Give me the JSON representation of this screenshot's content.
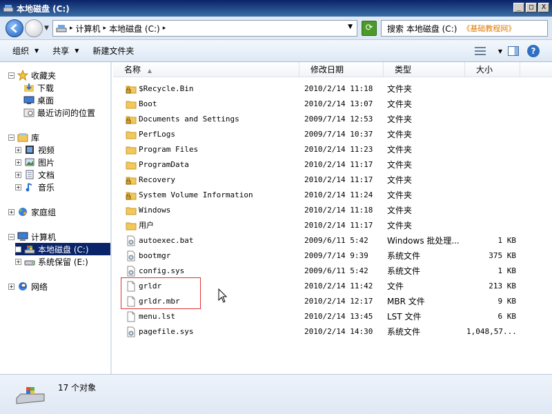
{
  "window": {
    "title": "本地磁盘 (C:)",
    "buttons": [
      "_",
      "□",
      "X"
    ]
  },
  "address": {
    "crumbs": [
      "计算机",
      "本地磁盘 (C:)"
    ],
    "search_placeholder": "搜索 本地磁盘 (C:)",
    "watermark": "《基础教程网》"
  },
  "toolbar": {
    "organize": "组织",
    "share": "共享",
    "new_folder": "新建文件夹"
  },
  "nav": {
    "favorites": "收藏夹",
    "downloads": "下载",
    "desktop": "桌面",
    "recent": "最近访问的位置",
    "libraries": "库",
    "videos": "视频",
    "pictures": "图片",
    "documents": "文档",
    "music": "音乐",
    "homegroup": "家庭组",
    "computer": "计算机",
    "local_disk": "本地磁盘 (C:)",
    "system_reserved": "系统保留 (E:)",
    "network": "网络"
  },
  "columns": {
    "name": "名称",
    "date": "修改日期",
    "type": "类型",
    "size": "大小"
  },
  "files": [
    {
      "name": "$Recycle.Bin",
      "date": "2010/2/14 11:18",
      "type": "文件夹",
      "size": "",
      "icon": "locked-folder-icon"
    },
    {
      "name": "Boot",
      "date": "2010/2/14 13:07",
      "type": "文件夹",
      "size": "",
      "icon": "folder-icon"
    },
    {
      "name": "Documents and Settings",
      "date": "2009/7/14 12:53",
      "type": "文件夹",
      "size": "",
      "icon": "locked-folder-icon"
    },
    {
      "name": "PerfLogs",
      "date": "2009/7/14 10:37",
      "type": "文件夹",
      "size": "",
      "icon": "folder-icon"
    },
    {
      "name": "Program Files",
      "date": "2010/2/14 11:23",
      "type": "文件夹",
      "size": "",
      "icon": "folder-icon"
    },
    {
      "name": "ProgramData",
      "date": "2010/2/14 11:17",
      "type": "文件夹",
      "size": "",
      "icon": "folder-icon"
    },
    {
      "name": "Recovery",
      "date": "2010/2/14 11:17",
      "type": "文件夹",
      "size": "",
      "icon": "locked-folder-icon"
    },
    {
      "name": "System Volume Information",
      "date": "2010/2/14 11:24",
      "type": "文件夹",
      "size": "",
      "icon": "locked-folder-icon"
    },
    {
      "name": "Windows",
      "date": "2010/2/14 11:18",
      "type": "文件夹",
      "size": "",
      "icon": "folder-icon"
    },
    {
      "name": "用户",
      "date": "2010/2/14 11:17",
      "type": "文件夹",
      "size": "",
      "icon": "folder-icon"
    },
    {
      "name": "autoexec.bat",
      "date": "2009/6/11 5:42",
      "type": "Windows 批处理...",
      "size": "1 KB",
      "icon": "system-file-icon"
    },
    {
      "name": "bootmgr",
      "date": "2009/7/14 9:39",
      "type": "系统文件",
      "size": "375 KB",
      "icon": "system-file-icon"
    },
    {
      "name": "config.sys",
      "date": "2009/6/11 5:42",
      "type": "系统文件",
      "size": "1 KB",
      "icon": "system-file-icon"
    },
    {
      "name": "grldr",
      "date": "2010/2/14 11:42",
      "type": "文件",
      "size": "213 KB",
      "icon": "blank-file-icon"
    },
    {
      "name": "grldr.mbr",
      "date": "2010/2/14 12:17",
      "type": "MBR 文件",
      "size": "9 KB",
      "icon": "blank-file-icon"
    },
    {
      "name": "menu.lst",
      "date": "2010/2/14 13:45",
      "type": "LST 文件",
      "size": "6 KB",
      "icon": "blank-file-icon"
    },
    {
      "name": "pagefile.sys",
      "date": "2010/2/14 14:30",
      "type": "系统文件",
      "size": "1,048,57...",
      "icon": "system-file-icon"
    }
  ],
  "status": {
    "count": "17 个对象"
  },
  "colors": {
    "title_bar": "#0a246a",
    "selection": "#0a246a",
    "highlight_box": "#e03030",
    "folder": "#f3c85a"
  }
}
